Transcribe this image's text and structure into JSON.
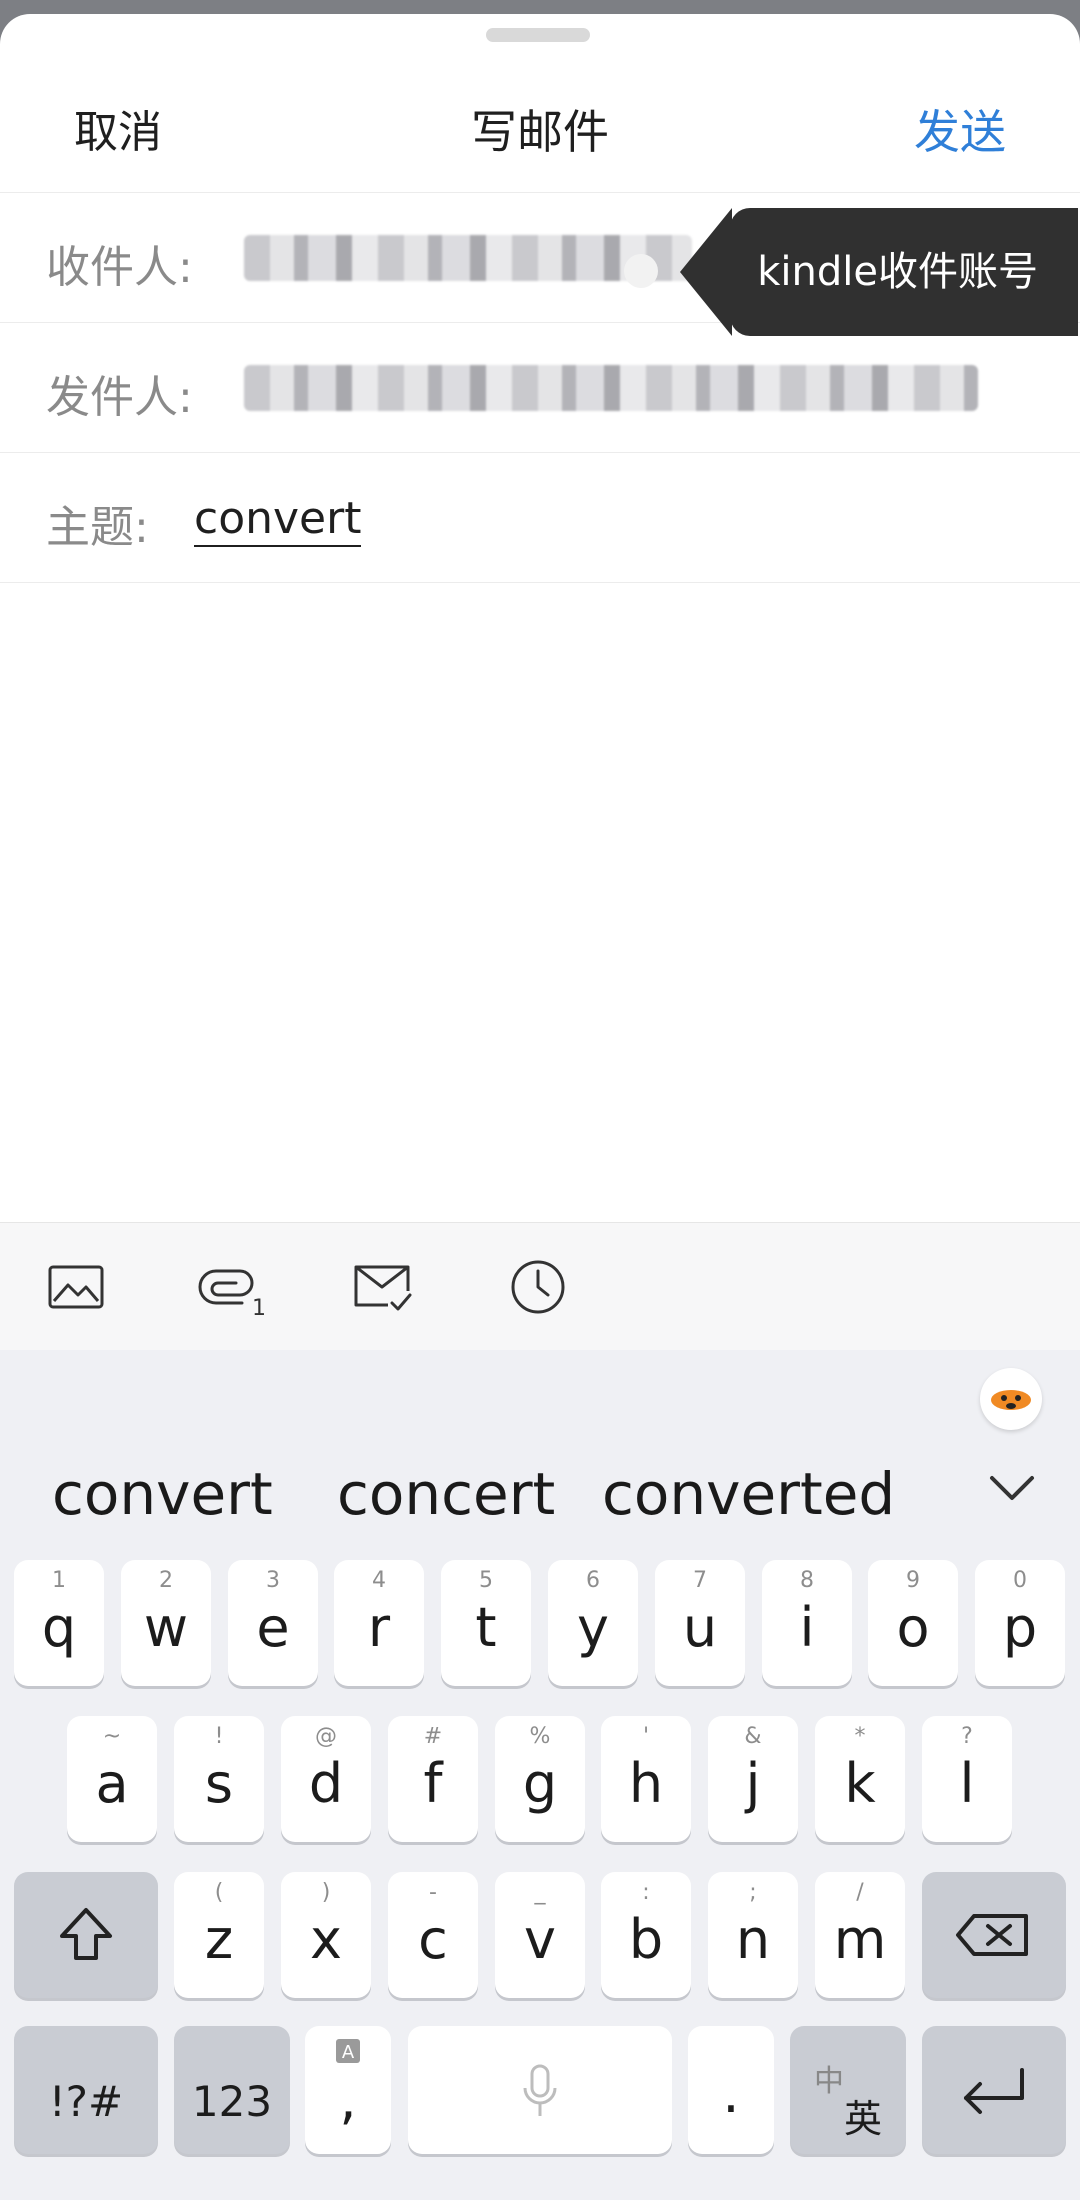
{
  "header": {
    "cancel_label": "取消",
    "title": "写邮件",
    "send_label": "发送"
  },
  "fields": {
    "to_label": "收件人:",
    "from_label": "发件人:",
    "subject_label": "主题:",
    "subject_value": "convert",
    "tooltip": "kindle收件账号"
  },
  "toolbar": {
    "icons": [
      "image-icon",
      "attachment-icon",
      "mail-check-icon",
      "clock-icon"
    ]
  },
  "keyboard": {
    "suggestions": [
      "convert",
      "concert",
      "converted"
    ],
    "row1": [
      {
        "key": "q",
        "sup": "1"
      },
      {
        "key": "w",
        "sup": "2"
      },
      {
        "key": "e",
        "sup": "3"
      },
      {
        "key": "r",
        "sup": "4"
      },
      {
        "key": "t",
        "sup": "5"
      },
      {
        "key": "y",
        "sup": "6"
      },
      {
        "key": "u",
        "sup": "7"
      },
      {
        "key": "i",
        "sup": "8"
      },
      {
        "key": "o",
        "sup": "9"
      },
      {
        "key": "p",
        "sup": "0"
      }
    ],
    "row2": [
      {
        "key": "a",
        "sup": "~"
      },
      {
        "key": "s",
        "sup": "!"
      },
      {
        "key": "d",
        "sup": "@"
      },
      {
        "key": "f",
        "sup": "#"
      },
      {
        "key": "g",
        "sup": "%"
      },
      {
        "key": "h",
        "sup": "'"
      },
      {
        "key": "j",
        "sup": "&"
      },
      {
        "key": "k",
        "sup": "*"
      },
      {
        "key": "l",
        "sup": "?"
      }
    ],
    "row3": [
      {
        "key": "z",
        "sup": "("
      },
      {
        "key": "x",
        "sup": ")"
      },
      {
        "key": "c",
        "sup": "-"
      },
      {
        "key": "v",
        "sup": "_"
      },
      {
        "key": "b",
        "sup": ":"
      },
      {
        "key": "n",
        "sup": ";"
      },
      {
        "key": "m",
        "sup": "/"
      }
    ],
    "symbols_label": "!?#",
    "numbers_label": "123",
    "comma_label": ",",
    "period_label": ".",
    "lang_cn": "中",
    "lang_en": "英"
  }
}
